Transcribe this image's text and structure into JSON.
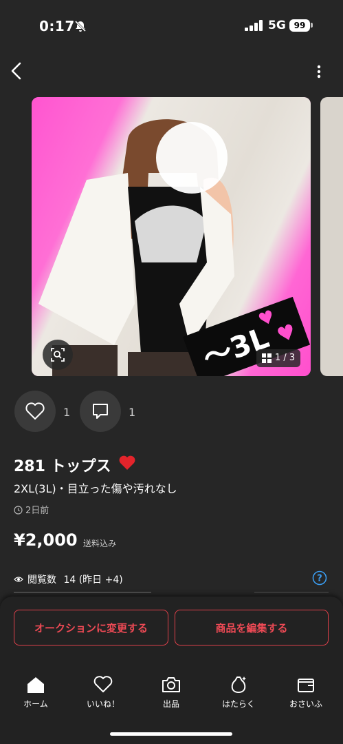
{
  "status_bar": {
    "time": "0:17",
    "network": "5G",
    "battery": "99"
  },
  "header": {
    "back_icon": "chevron-left-icon",
    "more_icon": "vertical-dots-icon"
  },
  "carousel": {
    "sticker_text": "〜3L",
    "counter": "1 / 3",
    "colors": {
      "background": "#ff5fd2",
      "sticker": "#0b0b0b"
    }
  },
  "engagement": {
    "likes": "1",
    "comments": "1"
  },
  "item": {
    "title": "281 トップス",
    "subtitle": "2XL(3L)・目立った傷や汚れなし",
    "posted": "2日前",
    "price": "¥2,000",
    "price_note": "送料込み",
    "views_label": "閲覧数",
    "views_value": "14 (昨日 +4)"
  },
  "actions": {
    "auction_label": "オークションに変更する",
    "edit_label": "商品を編集する",
    "accent_color": "#ee4a55"
  },
  "bottom_nav": [
    {
      "label": "ホーム",
      "icon": "home-icon",
      "active": true
    },
    {
      "label": "いいね！",
      "icon": "heart-icon"
    },
    {
      "label": "出品",
      "icon": "camera-icon"
    },
    {
      "label": "はたらく",
      "icon": "bag-icon"
    },
    {
      "label": "おさいふ",
      "icon": "wallet-icon"
    }
  ]
}
